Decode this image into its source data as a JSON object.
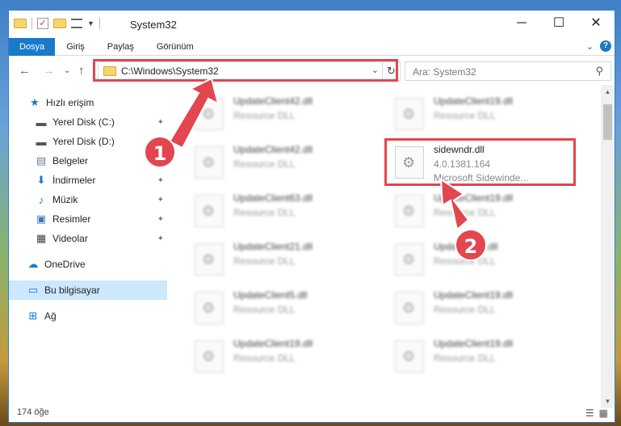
{
  "window": {
    "title": "System32",
    "minimize_label": "─",
    "maximize_label": "☐",
    "close_label": "✕"
  },
  "ribbon": {
    "tabs": [
      "Dosya",
      "Giriş",
      "Paylaş",
      "Görünüm"
    ],
    "expand_label": "⌄",
    "help_label": "?"
  },
  "navigation": {
    "back_label": "←",
    "forward_label": "→",
    "recent_label": "⌄",
    "up_label": "↑"
  },
  "address_bar": {
    "path": "C:\\Windows\\System32",
    "dropdown_label": "⌄",
    "refresh_label": "↻"
  },
  "search": {
    "placeholder": "Ara: System32",
    "icon_label": "⚲"
  },
  "sidebar": {
    "items": [
      {
        "label": "Hızlı erişim",
        "icon": "star-icon",
        "glyph": "★",
        "color": "#1979ca",
        "pinned": false
      },
      {
        "label": "Yerel Disk (C:)",
        "icon": "drive-icon",
        "glyph": "▬",
        "color": "#555555",
        "pinned": true
      },
      {
        "label": "Yerel Disk (D:)",
        "icon": "drive-icon",
        "glyph": "▬",
        "color": "#555555",
        "pinned": false
      },
      {
        "label": "Belgeler",
        "icon": "documents-icon",
        "glyph": "▤",
        "color": "#6a7f96",
        "pinned": false
      },
      {
        "label": "İndirmeler",
        "icon": "download-icon",
        "glyph": "⬇",
        "color": "#1979ca",
        "pinned": true
      },
      {
        "label": "Müzik",
        "icon": "music-icon",
        "glyph": "♪",
        "color": "#1979ca",
        "pinned": true
      },
      {
        "label": "Resimler",
        "icon": "pictures-icon",
        "glyph": "▣",
        "color": "#3a7bbf",
        "pinned": true
      },
      {
        "label": "Videolar",
        "icon": "video-icon",
        "glyph": "▦",
        "color": "#444444",
        "pinned": true
      },
      {
        "label": "OneDrive",
        "icon": "cloud-icon",
        "glyph": "☁",
        "color": "#1979ca",
        "pinned": false
      },
      {
        "label": "Bu bilgisayar",
        "icon": "computer-icon",
        "glyph": "▭",
        "color": "#1979ca",
        "pinned": false,
        "selected": true
      },
      {
        "label": "Ağ",
        "icon": "network-icon",
        "glyph": "⊞",
        "color": "#1979ca",
        "pinned": false
      }
    ],
    "pin_glyph": "📌"
  },
  "files": {
    "left": [
      {
        "name": "UpdateClient42.dll",
        "desc": "Resource DLL"
      },
      {
        "name": "UpdateClient42.dll",
        "desc": "Resource DLL"
      },
      {
        "name": "UpdateClient63.dll",
        "desc": "Resource DLL"
      },
      {
        "name": "UpdateClient21.dll",
        "desc": "Resource DLL"
      },
      {
        "name": "UpdateClient5.dll",
        "desc": "Resource DLL"
      },
      {
        "name": "UpdateClient19.dll",
        "desc": "Resource DLL"
      }
    ],
    "right": [
      {
        "name": "UpdateClient19.dll",
        "desc": "Resource DLL"
      },
      {
        "name": "sidewndr.dll",
        "desc": "4.0.1381.164",
        "desc2": "Microsoft Sidewinde..."
      },
      {
        "name": "UpdateClient19.dll",
        "desc": "Resource DLL"
      },
      {
        "name": "Update…65.dll",
        "desc": "Resource DLL"
      },
      {
        "name": "UpdateClient19.dll",
        "desc": "Resource DLL"
      },
      {
        "name": "UpdateClient19.dll",
        "desc": "Resource DLL"
      }
    ]
  },
  "callouts": [
    "1",
    "2"
  ],
  "status": {
    "count_text": "174 öğe"
  },
  "colors": {
    "accent": "#1979ca",
    "highlight": "#e2464e",
    "selected": "#cce8ff"
  }
}
